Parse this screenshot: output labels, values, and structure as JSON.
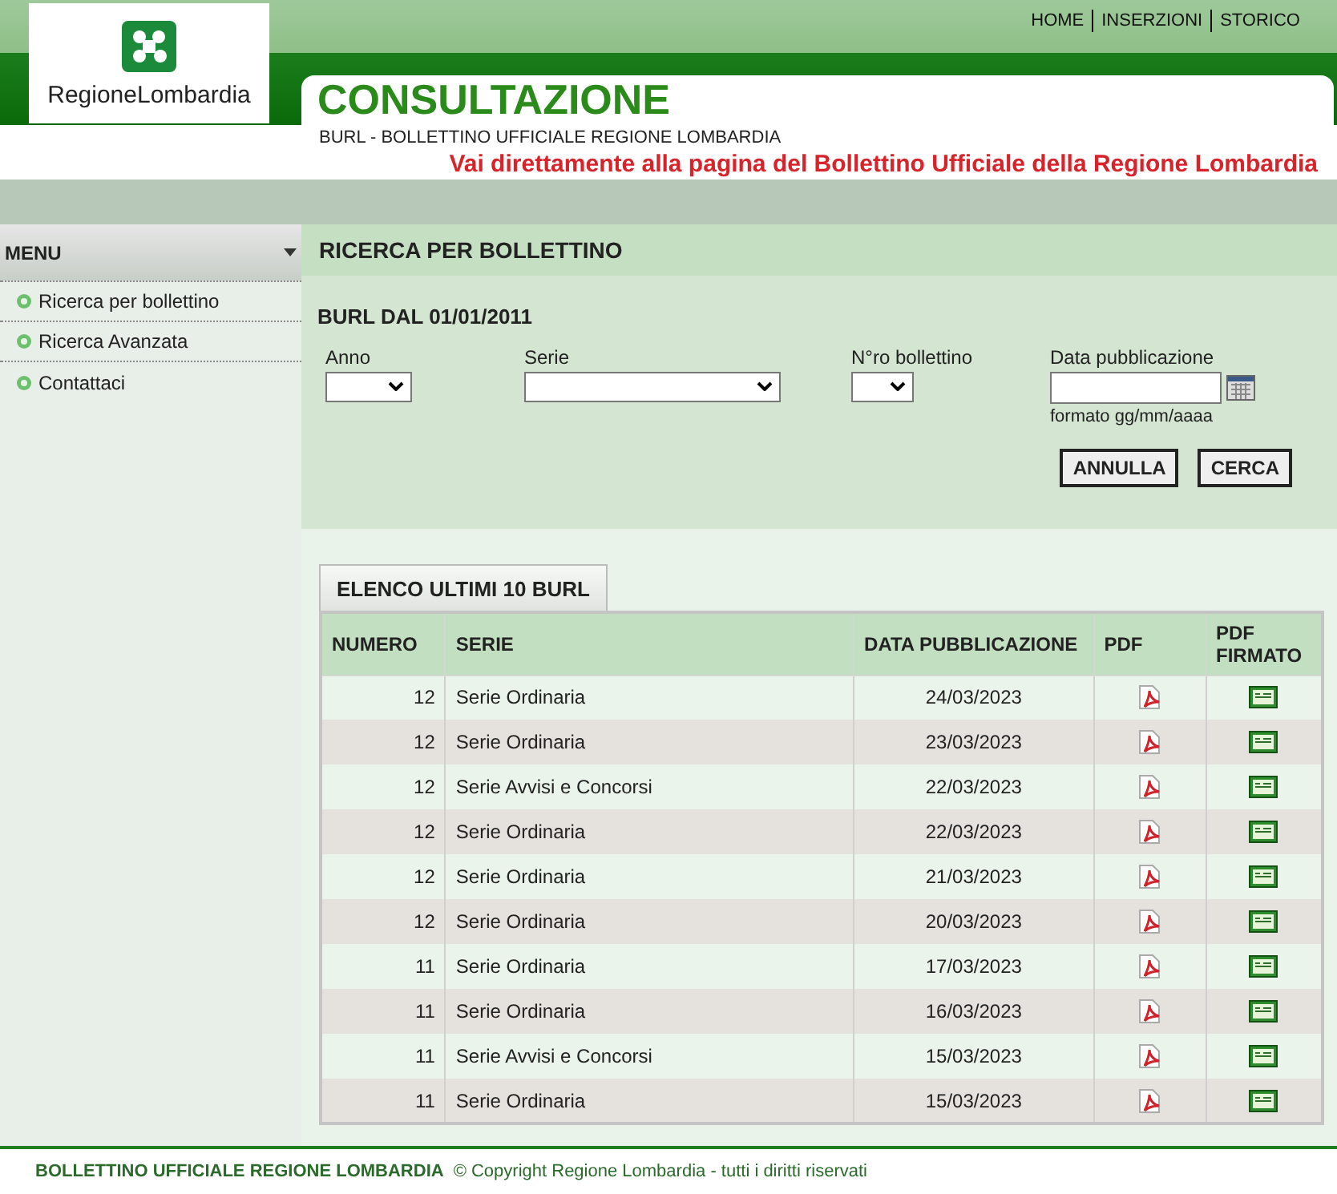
{
  "header": {
    "logo_text": "RegioneLombardia",
    "nav": [
      "HOME",
      "INSERZIONI",
      "STORICO"
    ],
    "title": "CONSULTAZIONE",
    "subtitle": "BURL - BOLLETTINO UFFICIALE REGIONE LOMBARDIA",
    "link": "Vai direttamente alla pagina del Bollettino Ufficiale della Regione Lombardia"
  },
  "sidebar": {
    "title": "MENU",
    "items": [
      "Ricerca per bollettino",
      "Ricerca Avanzata",
      "Contattaci"
    ]
  },
  "search": {
    "title": "RICERCA PER BOLLETTINO",
    "subtitle": "BURL DAL 01/01/2011",
    "anno_label": "Anno",
    "serie_label": "Serie",
    "numero_label": "N°ro bollettino",
    "data_label": "Data pubblicazione",
    "data_hint": "formato gg/mm/aaaa",
    "buttons": [
      "ANNULLA",
      "CERCA"
    ]
  },
  "list": {
    "tab": "ELENCO ULTIMI 10 BURL",
    "columns": [
      "NUMERO",
      "SERIE",
      "DATA PUBBLICAZIONE",
      "PDF",
      "PDF FIRMATO"
    ],
    "rows": [
      {
        "numero": "12",
        "serie": "Serie Ordinaria",
        "data": "24/03/2023"
      },
      {
        "numero": "12",
        "serie": "Serie Ordinaria",
        "data": "23/03/2023"
      },
      {
        "numero": "12",
        "serie": "Serie Avvisi e Concorsi",
        "data": "22/03/2023"
      },
      {
        "numero": "12",
        "serie": "Serie Ordinaria",
        "data": "22/03/2023"
      },
      {
        "numero": "12",
        "serie": "Serie Ordinaria",
        "data": "21/03/2023"
      },
      {
        "numero": "12",
        "serie": "Serie Ordinaria",
        "data": "20/03/2023"
      },
      {
        "numero": "11",
        "serie": "Serie Ordinaria",
        "data": "17/03/2023"
      },
      {
        "numero": "11",
        "serie": "Serie Ordinaria",
        "data": "16/03/2023"
      },
      {
        "numero": "11",
        "serie": "Serie Avvisi e Concorsi",
        "data": "15/03/2023"
      },
      {
        "numero": "11",
        "serie": "Serie Ordinaria",
        "data": "15/03/2023"
      }
    ]
  },
  "footer": {
    "title": "BOLLETTINO UFFICIALE REGIONE LOMBARDIA",
    "copyright": "© Copyright Regione Lombardia - tutti i diritti riservati"
  }
}
